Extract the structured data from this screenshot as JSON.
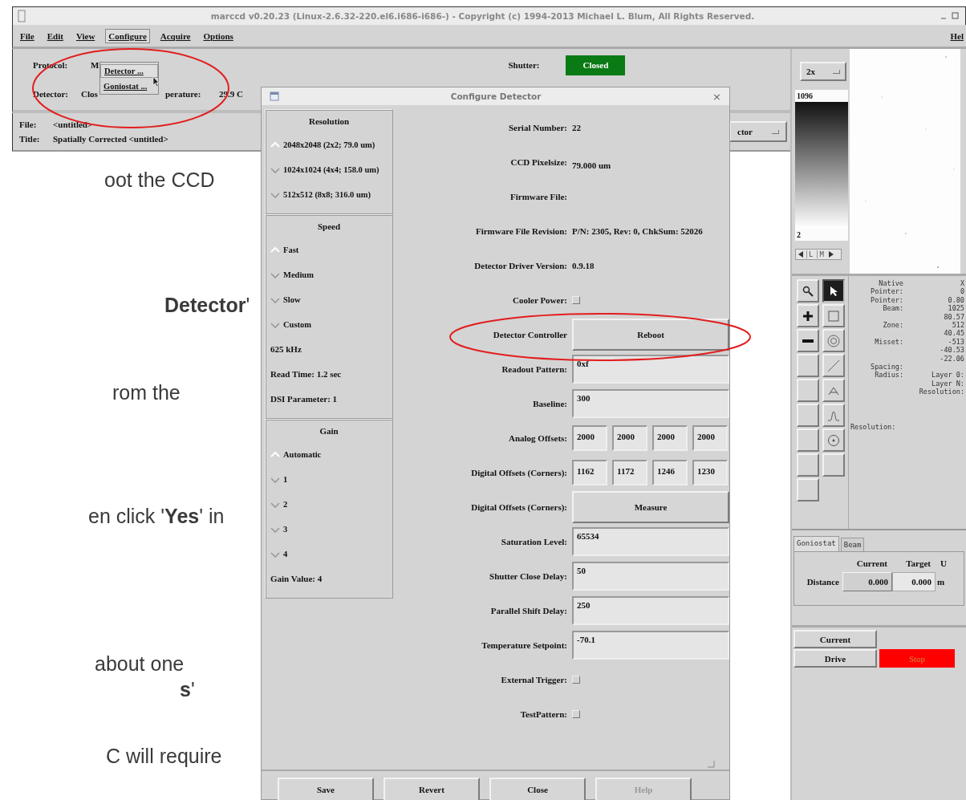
{
  "slide_text": [
    "oot the CCD",
    "**Detector**'",
    "rom the",
    "en click '**Yes**' in",
    "about one",
    "**s**'",
    "C will require"
  ],
  "main_window": {
    "title": "marccd  v0.20.23 (Linux-2.6.32-220.el6.i686-i686-) - Copyright (c) 1994-2013 Michael L. Blum, All Rights Reserved.",
    "menu": [
      {
        "label": "File",
        "selected": false
      },
      {
        "label": "Edit",
        "selected": false
      },
      {
        "label": "View",
        "selected": false
      },
      {
        "label": "Configure",
        "selected": true
      },
      {
        "label": "Acquire",
        "selected": false
      },
      {
        "label": "Options",
        "selected": false
      }
    ],
    "help_menu": "Hel",
    "configure_menu": [
      "Detector ...",
      "Goniostat ..."
    ],
    "protocol": {
      "label": "Protocol:",
      "value": "M"
    },
    "detector": {
      "label": "Detector:",
      "value": "Clos"
    },
    "temperature": {
      "label": "perature:",
      "value": "29.9 C"
    },
    "shutter": {
      "label": "Shutter:",
      "value": "Closed"
    },
    "file": {
      "label": "File:",
      "value": "<untitled>"
    },
    "image_title": {
      "label": "Title:",
      "value": "Spatially Corrected <untitled>"
    },
    "mode_dropdown": "ctor"
  },
  "image_panel": {
    "zoom": "2x",
    "max": "1096",
    "min": "2",
    "nav_labels": [
      "L",
      "M"
    ]
  },
  "tools": [
    {
      "kind": "magnifier",
      "selected": false
    },
    {
      "kind": "pointer",
      "selected": true
    },
    {
      "kind": "plus",
      "selected": false
    },
    {
      "kind": "square",
      "selected": false
    },
    {
      "kind": "minus",
      "selected": false
    },
    {
      "kind": "target",
      "selected": false
    },
    {
      "kind": "blank",
      "selected": false
    },
    {
      "kind": "line",
      "selected": false
    },
    {
      "kind": "blank",
      "selected": false
    },
    {
      "kind": "triangle",
      "selected": false
    },
    {
      "kind": "blank",
      "selected": false
    },
    {
      "kind": "peak",
      "selected": false
    },
    {
      "kind": "blank",
      "selected": false
    },
    {
      "kind": "dot-circle",
      "selected": false
    },
    {
      "kind": "blank",
      "selected": false
    },
    {
      "kind": "blank",
      "selected": false
    },
    {
      "kind": "blank",
      "selected": false
    }
  ],
  "info": [
    {
      "label": "Native",
      "value": "X"
    },
    {
      "label": "Pointer:",
      "value": "0"
    },
    {
      "label": "Pointer:",
      "value": "0.80"
    },
    {
      "label": "Beam:",
      "value": "1025"
    },
    {
      "value": "80.57"
    },
    {
      "label": "Zone:",
      "value": "512"
    },
    {
      "value": "40.45"
    },
    {
      "label": "Misset:",
      "value": "-513"
    },
    {
      "value": "-40.53"
    },
    {
      "value": "-22.06"
    },
    {
      "label": "Spacing:"
    },
    {
      "label": "Radius:",
      "value": "Layer 0:"
    },
    {
      "value": "Layer N:"
    },
    {
      "value": "Resolution:"
    }
  ],
  "info_footer": "Resolution:",
  "tabs": [
    {
      "label": "Goniostat",
      "selected": true
    },
    {
      "label": "Beam",
      "selected": false
    }
  ],
  "goniostat": {
    "columns": [
      "Current",
      "Target",
      "U"
    ],
    "rows": [
      {
        "label": "Distance",
        "current": "0.000",
        "target": "0.000",
        "unit": "m"
      }
    ]
  },
  "drive": {
    "current_button": "Current",
    "drive_button": "Drive",
    "stop_button": "Stop"
  },
  "dialog": {
    "title": "Configure Detector",
    "close_glyph": "×",
    "groups": [
      {
        "title": "Resolution",
        "options": [
          {
            "label": "2048x2048 (2x2; 79.0 um)",
            "selected": true
          },
          {
            "label": "1024x1024 (4x4; 158.0 um)",
            "selected": false
          },
          {
            "label": "512x512 (8x8; 316.0 um)",
            "selected": false
          }
        ]
      },
      {
        "title": "Speed",
        "options": [
          {
            "label": "Fast",
            "selected": true
          },
          {
            "label": "Medium",
            "selected": false
          },
          {
            "label": "Slow",
            "selected": false
          },
          {
            "label": "Custom",
            "selected": false
          }
        ],
        "notes": [
          "625  kHz",
          "Read Time: 1.2  sec",
          "DSI Parameter: 1"
        ]
      },
      {
        "title": "Gain",
        "options": [
          {
            "label": "Automatic",
            "selected": true
          },
          {
            "label": "1",
            "selected": false
          },
          {
            "label": "2",
            "selected": false
          },
          {
            "label": "3",
            "selected": false
          },
          {
            "label": "4",
            "selected": false
          }
        ],
        "notes": [
          "Gain Value: 4"
        ]
      }
    ],
    "rows": [
      {
        "kind": "text",
        "label": "Serial Number:",
        "value": "22"
      },
      {
        "kind": "raised",
        "label": "CCD Pixelsize:",
        "value": "79.000 um"
      },
      {
        "kind": "text",
        "label": "Firmware File:"
      },
      {
        "kind": "text",
        "label": "Firmware File Revision:",
        "value": "P/N: 2305, Rev: 0, ChkSum: 52026"
      },
      {
        "kind": "text",
        "label": "Detector Driver Version:",
        "value": "0.9.18"
      },
      {
        "kind": "checkbox",
        "label": "Cooler Power:",
        "checked": false
      },
      {
        "kind": "button",
        "label": "Detector Controller",
        "value": "Reboot"
      },
      {
        "kind": "field",
        "label": "Readout Pattern:",
        "value": "0xf"
      },
      {
        "kind": "field",
        "label": "Baseline:",
        "value": "300"
      },
      {
        "kind": "fields",
        "label": "Analog Offsets:",
        "values": [
          "2000",
          "2000",
          "2000",
          "2000"
        ]
      },
      {
        "kind": "fields",
        "label": "Digital Offsets (Corners):",
        "values": [
          "1162",
          "1172",
          "1246",
          "1230"
        ]
      },
      {
        "kind": "button",
        "label": "Digital Offsets (Corners):",
        "value": "Measure"
      },
      {
        "kind": "field",
        "label": "Saturation Level:",
        "value": "65534"
      },
      {
        "kind": "field",
        "label": "Shutter Close Delay:",
        "value": "50"
      },
      {
        "kind": "field",
        "label": "Parallel Shift Delay:",
        "value": "250"
      },
      {
        "kind": "field",
        "label": "Temperature Setpoint:",
        "value": "-70.1"
      },
      {
        "kind": "checkbox",
        "label": "External Trigger:",
        "checked": false
      },
      {
        "kind": "checkbox",
        "label": "TestPattern:",
        "checked": false
      }
    ],
    "buttons": [
      {
        "label": "Save",
        "disabled": false
      },
      {
        "label": "Revert",
        "disabled": false
      },
      {
        "label": "Close",
        "disabled": false
      },
      {
        "label": "Help",
        "disabled": true
      }
    ]
  }
}
